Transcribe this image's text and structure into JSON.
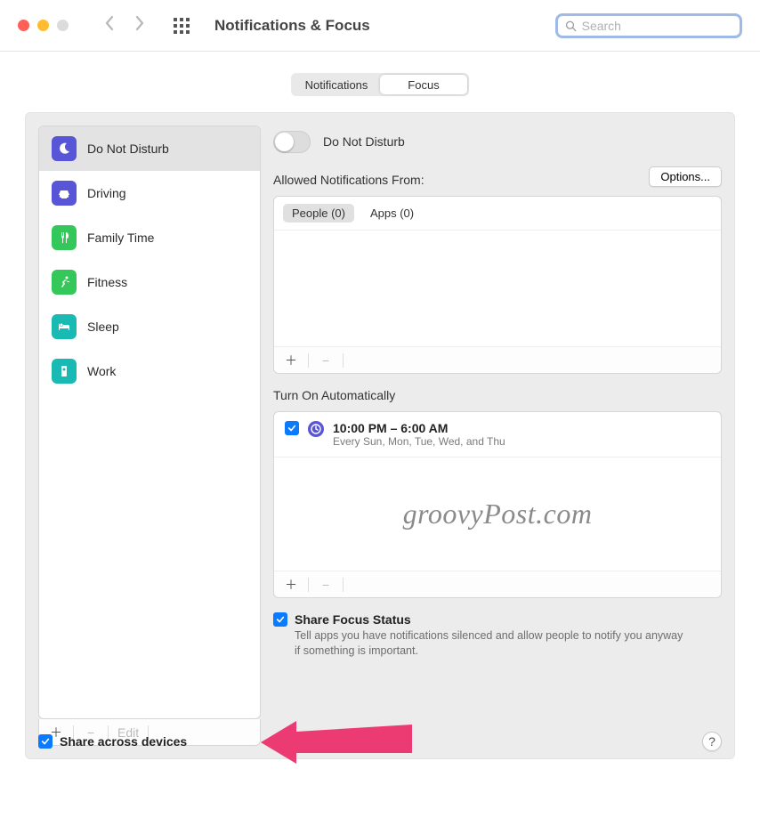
{
  "window": {
    "title": "Notifications & Focus"
  },
  "search": {
    "placeholder": "Search"
  },
  "tabs": {
    "notifications": "Notifications",
    "focus": "Focus"
  },
  "focus_modes": [
    {
      "label": "Do Not Disturb",
      "icon": "moon",
      "color": "#5856d6",
      "selected": true
    },
    {
      "label": "Driving",
      "icon": "car",
      "color": "#5856d6",
      "selected": false
    },
    {
      "label": "Family Time",
      "icon": "fork",
      "color": "#34c759",
      "selected": false
    },
    {
      "label": "Fitness",
      "icon": "run",
      "color": "#34c759",
      "selected": false
    },
    {
      "label": "Sleep",
      "icon": "bed",
      "color": "#19b9b4",
      "selected": false
    },
    {
      "label": "Work",
      "icon": "badge",
      "color": "#19b9b4",
      "selected": false
    }
  ],
  "sidebar_footer": {
    "edit": "Edit"
  },
  "detail": {
    "header": "Do Not Disturb",
    "allowed_label": "Allowed Notifications From:",
    "options_button": "Options...",
    "tabs": {
      "people": "People (0)",
      "apps": "Apps (0)"
    },
    "auto_label": "Turn On Automatically",
    "schedule": {
      "time": "10:00 PM – 6:00 AM",
      "days": "Every Sun, Mon, Tue, Wed, and Thu"
    },
    "watermark": "groovyPost.com",
    "share_status": {
      "label": "Share Focus Status",
      "desc": "Tell apps you have notifications silenced and allow people to notify you anyway if something is important."
    }
  },
  "share_across": "Share across devices"
}
